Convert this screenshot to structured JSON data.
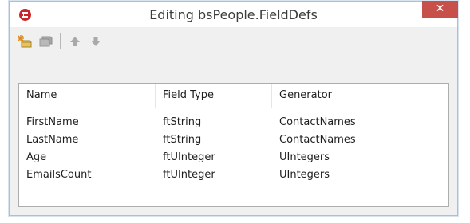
{
  "window": {
    "title": "Editing bsPeople.FieldDefs",
    "close_label": "✕"
  },
  "toolbar": {
    "buttons": [
      {
        "name": "add-new-icon",
        "enabled": true
      },
      {
        "name": "add-all-icon",
        "enabled": false
      },
      {
        "name": "move-up-icon",
        "enabled": false
      },
      {
        "name": "move-down-icon",
        "enabled": false
      }
    ]
  },
  "grid": {
    "columns": [
      "Name",
      "Field Type",
      "Generator"
    ],
    "rows": [
      [
        "FirstName",
        "ftString",
        "ContactNames"
      ],
      [
        "LastName",
        "ftString",
        "ContactNames"
      ],
      [
        "Age",
        "ftUInteger",
        "UIntegers"
      ],
      [
        "EmailsCount",
        "ftUInteger",
        "UIntegers"
      ]
    ]
  },
  "colors": {
    "close_button": "#c7504b",
    "app_icon": "#c9262c",
    "window_bg": "#f0f0f0",
    "border": "#a9c0d8"
  }
}
